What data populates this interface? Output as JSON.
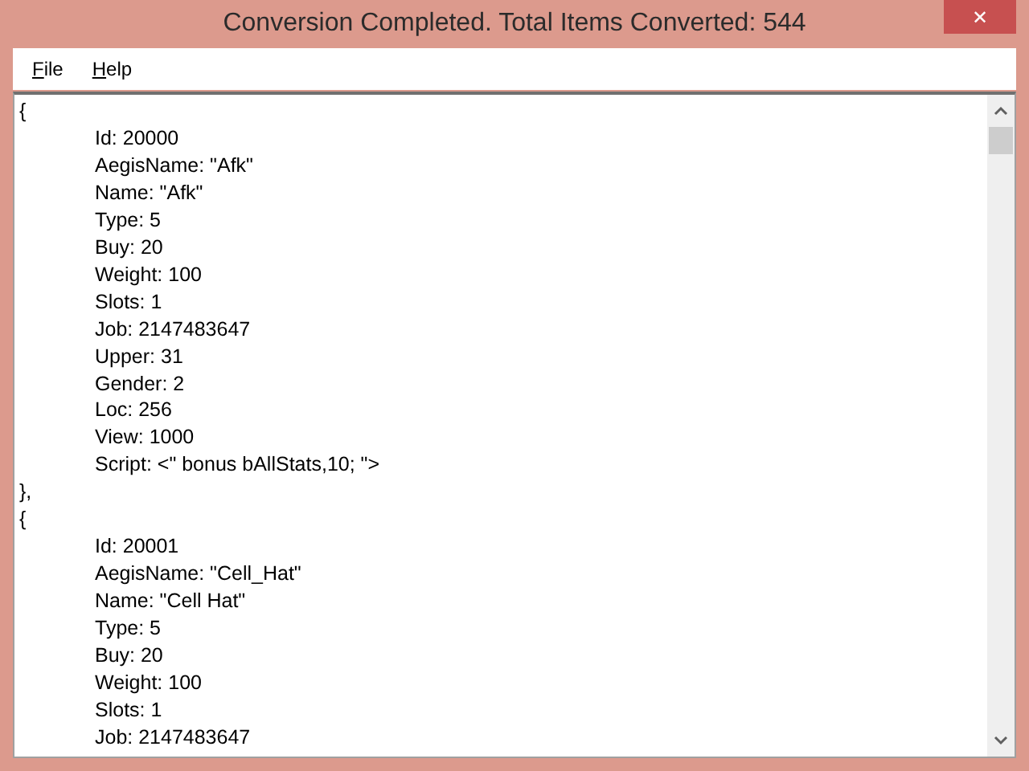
{
  "window": {
    "title": "Conversion Completed. Total Items Converted: 544",
    "close": "✕"
  },
  "menu": [
    {
      "label": "File"
    },
    {
      "label": "Help"
    }
  ],
  "editor": {
    "lines": [
      {
        "kind": "brace",
        "text": "{"
      },
      {
        "kind": "field",
        "text": "Id: 20000"
      },
      {
        "kind": "field",
        "text": "AegisName: \"Afk\""
      },
      {
        "kind": "field",
        "text": "Name: \"Afk\""
      },
      {
        "kind": "field",
        "text": "Type: 5"
      },
      {
        "kind": "field",
        "text": "Buy: 20"
      },
      {
        "kind": "field",
        "text": "Weight: 100"
      },
      {
        "kind": "field",
        "text": "Slots: 1"
      },
      {
        "kind": "field",
        "text": "Job: 2147483647"
      },
      {
        "kind": "field",
        "text": "Upper: 31"
      },
      {
        "kind": "field",
        "text": "Gender: 2"
      },
      {
        "kind": "field",
        "text": "Loc: 256"
      },
      {
        "kind": "field",
        "text": "View: 1000"
      },
      {
        "kind": "field",
        "text": "Script: <\" bonus bAllStats,10; \">"
      },
      {
        "kind": "brace",
        "text": "},"
      },
      {
        "kind": "brace",
        "text": "{"
      },
      {
        "kind": "field",
        "text": "Id: 20001"
      },
      {
        "kind": "field",
        "text": "AegisName: \"Cell_Hat\""
      },
      {
        "kind": "field",
        "text": "Name: \"Cell Hat\""
      },
      {
        "kind": "field",
        "text": "Type: 5"
      },
      {
        "kind": "field",
        "text": "Buy: 20"
      },
      {
        "kind": "field",
        "text": "Weight: 100"
      },
      {
        "kind": "field",
        "text": "Slots: 1"
      },
      {
        "kind": "field",
        "text": "Job: 2147483647"
      }
    ]
  }
}
